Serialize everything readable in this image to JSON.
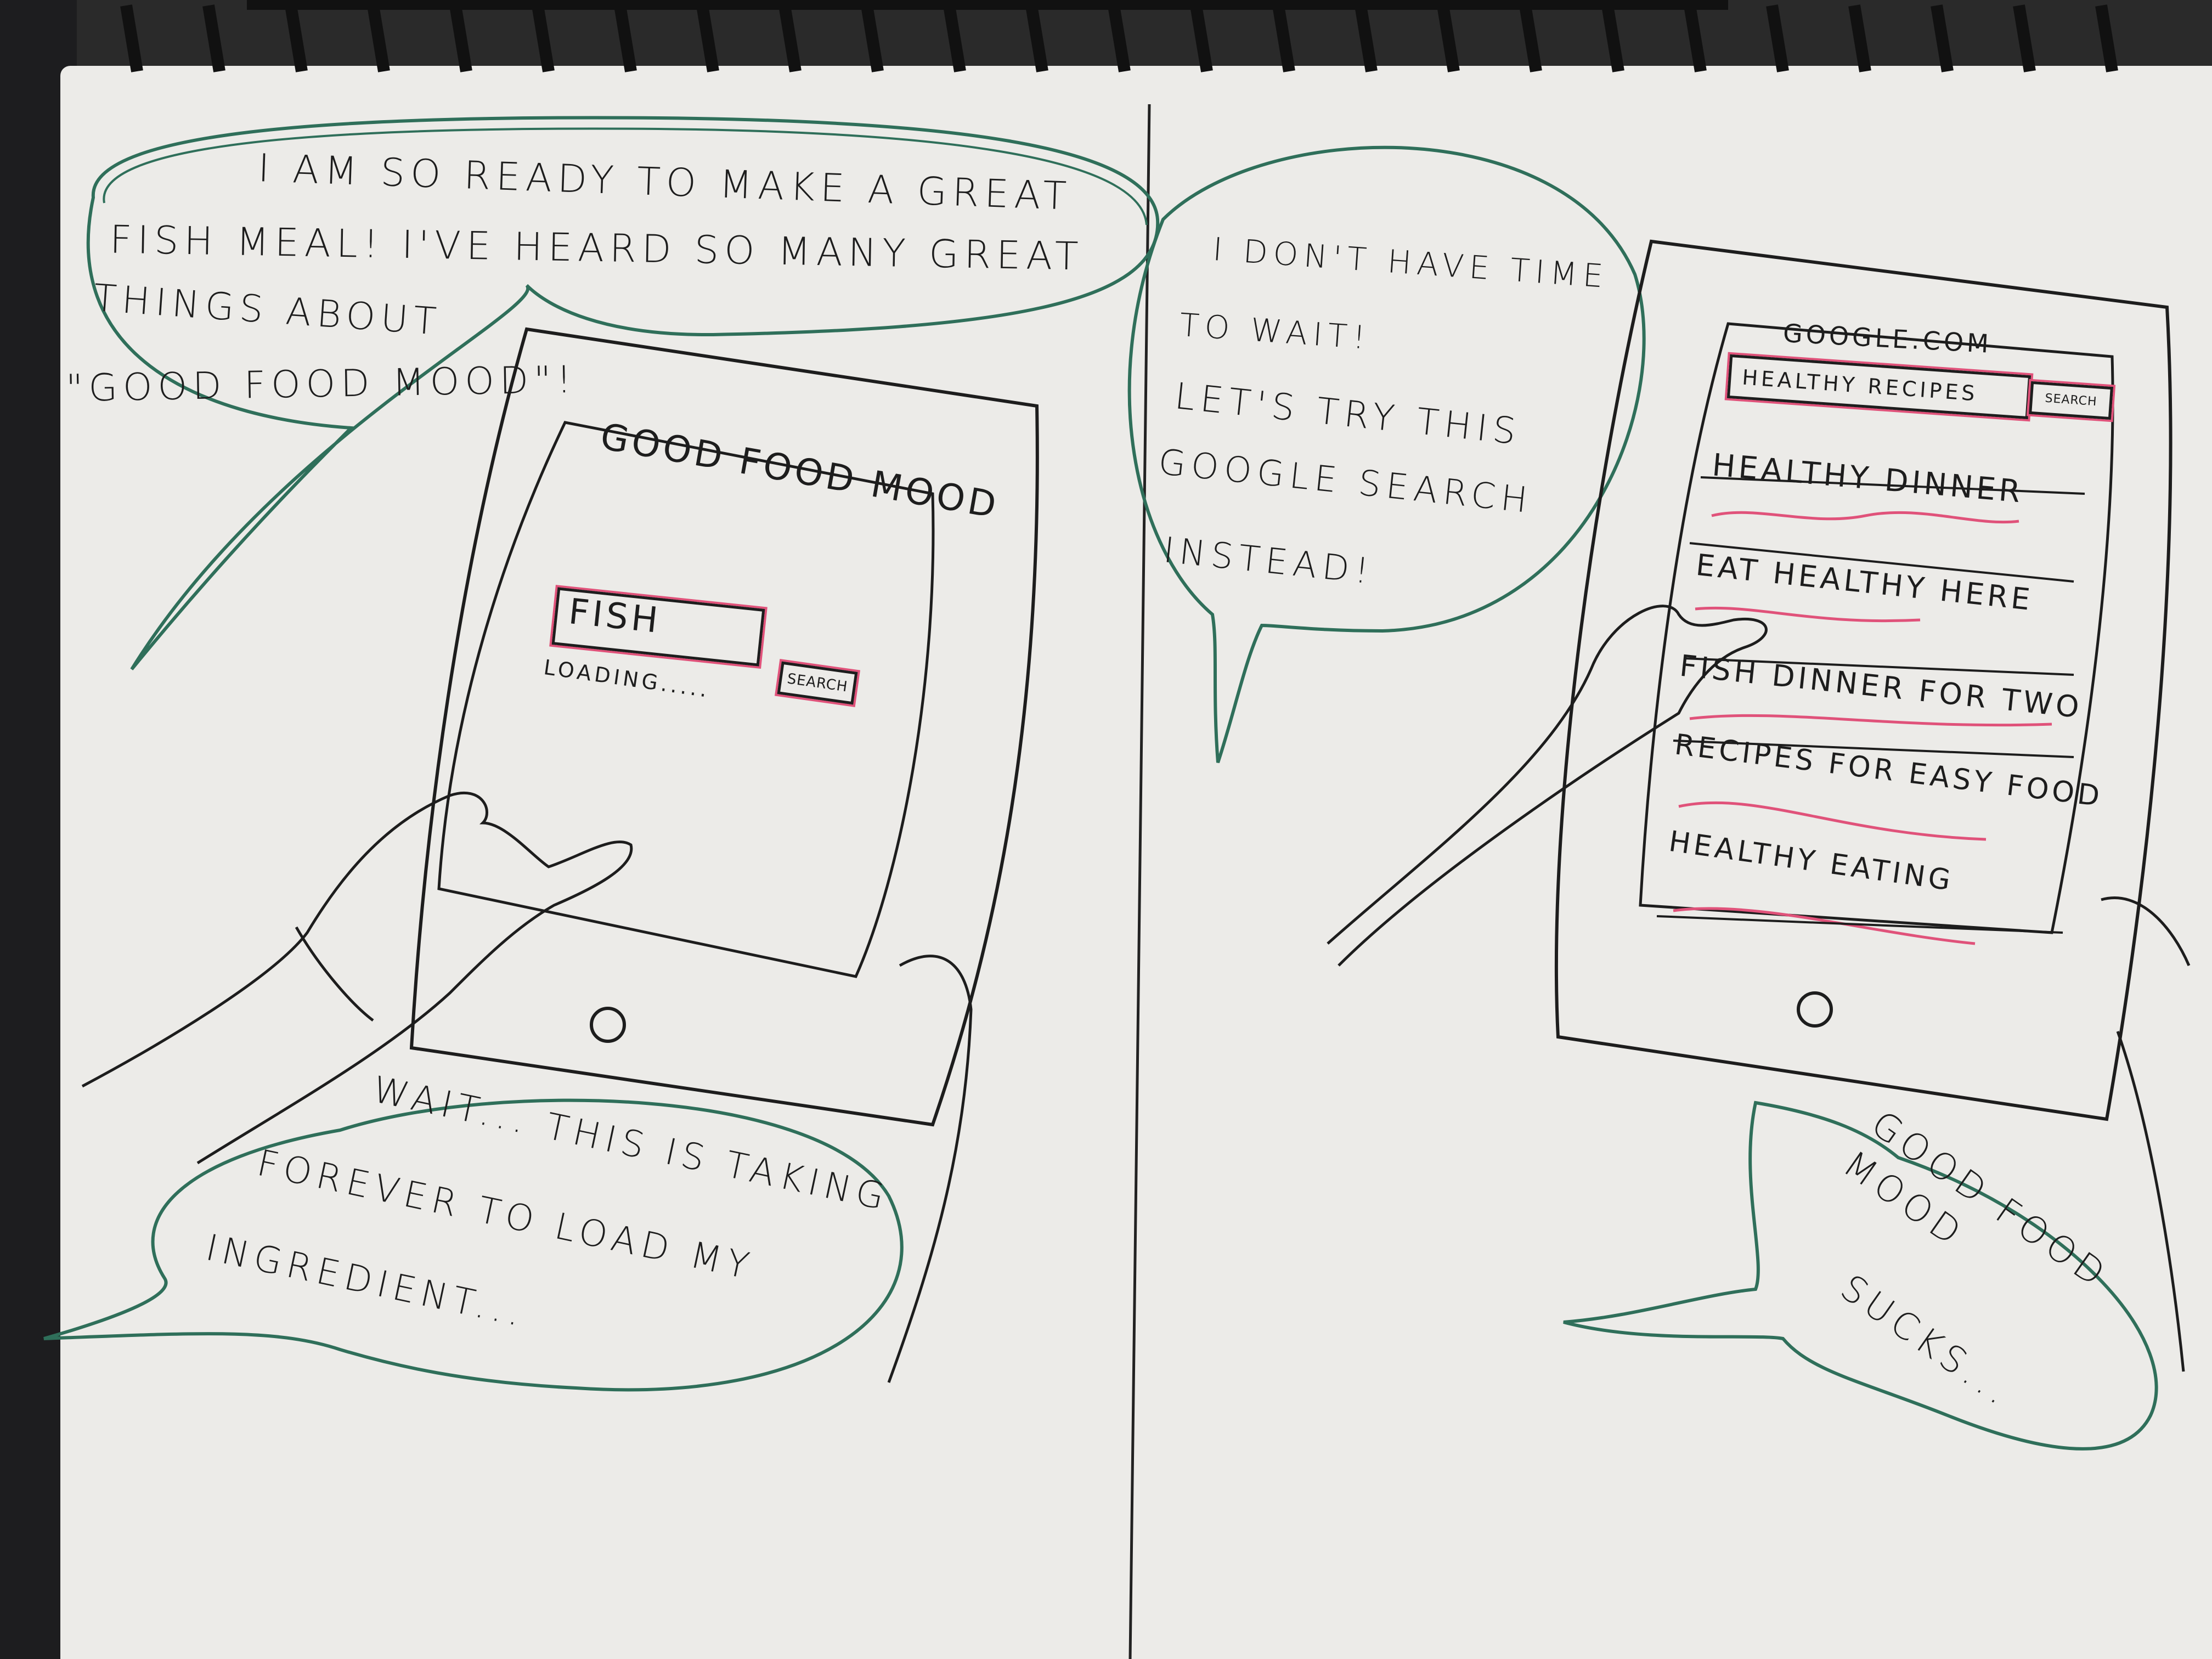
{
  "panel_left": {
    "bubble_top": "I am so ready to make a great fish meal! I've heard so many great things about \"Good Food Mood\"!",
    "bubble_top_lines": [
      "I AM SO READY TO MAKE A GREAT",
      "FISH MEAL! I'VE HEARD SO MANY GREAT",
      "THINGS ABOUT",
      "\"GOOD FOOD MOOD\"!"
    ],
    "app_title": "GOOD FOOD MOOD",
    "search_value": "FISH",
    "search_button": "SEARCH",
    "loading_text": "LOADING.....",
    "bubble_bottom_lines": [
      "WAIT... THIS IS TAKING",
      "FOREVER TO LOAD MY",
      "INGREDIENT..."
    ]
  },
  "panel_right": {
    "bubble_top_lines": [
      "I DON'T HAVE TIME",
      "TO WAIT!",
      "LET'S TRY THIS",
      "GOOGLE SEARCH",
      "INSTEAD!"
    ],
    "url": "GOOGLE.COM",
    "search_value": "HEALTHY RECIPES",
    "search_button": "SEARCH",
    "results": [
      "HEALTHY DINNER",
      "EAT HEALTHY HERE",
      "FISH DINNER FOR TWO",
      "RECIPES FOR EASY FOOD",
      "HEALTHY EATING"
    ],
    "bubble_bottom_lines": [
      "GOOD FOOD MOOD",
      "SUCKS..."
    ]
  },
  "colors": {
    "ink": "#1d1d1d",
    "bubble_green": "#2f6f5a",
    "highlight_red": "#e0527a",
    "paper": "#ecebe8"
  }
}
